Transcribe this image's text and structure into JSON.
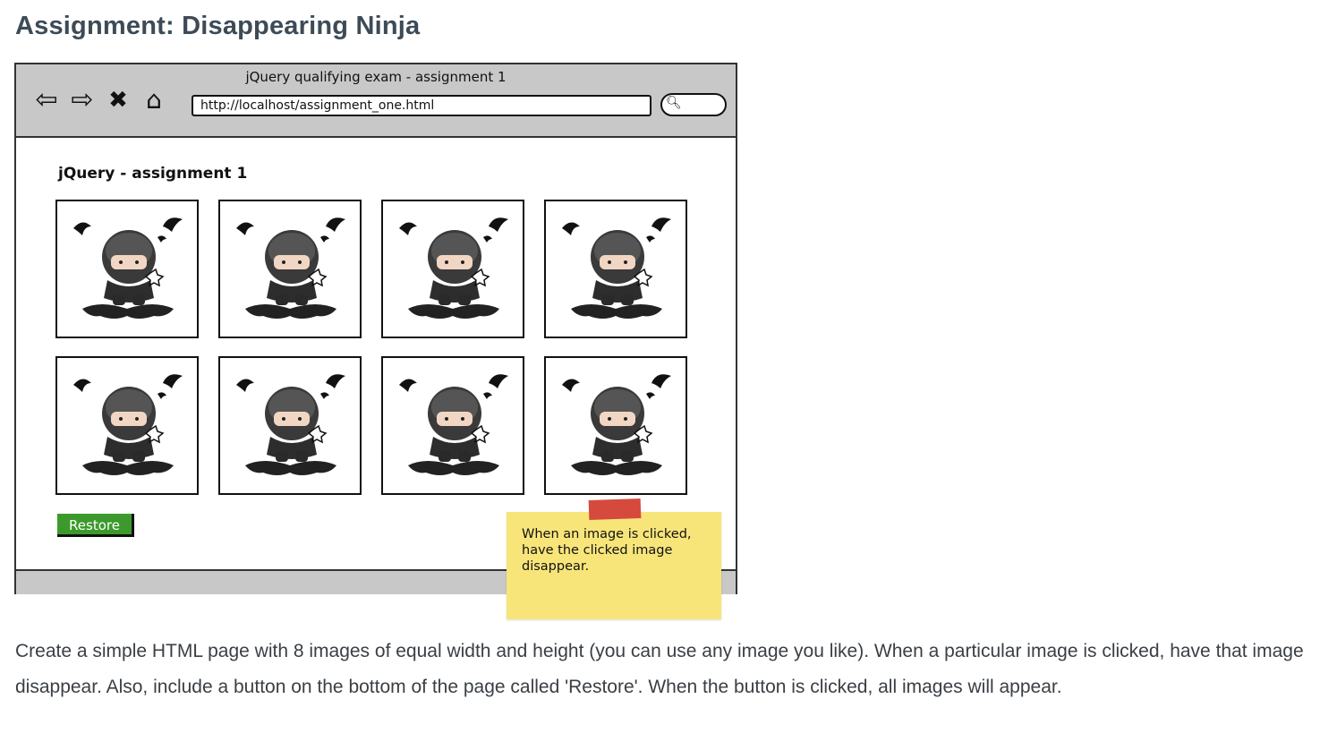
{
  "heading": "Assignment: Disappearing Ninja",
  "mockup": {
    "window_title": "jQuery qualifying exam - assignment 1",
    "nav_icons": [
      "back-arrow-icon",
      "forward-arrow-icon",
      "close-icon",
      "home-icon"
    ],
    "url": "http://localhost/assignment_one.html",
    "search_icon": "search-icon",
    "page_title": "jQuery - assignment 1",
    "images": [
      {
        "icon": "ninja-image"
      },
      {
        "icon": "ninja-image"
      },
      {
        "icon": "ninja-image"
      },
      {
        "icon": "ninja-image"
      },
      {
        "icon": "ninja-image"
      },
      {
        "icon": "ninja-image"
      },
      {
        "icon": "ninja-image"
      },
      {
        "icon": "ninja-image"
      }
    ],
    "restore_label": "Restore",
    "sticky_note": "When an image is clicked, have the clicked image disappear."
  },
  "description": "Create a simple HTML page with 8 images of equal width and height (you can use any image you like). When a particular image is clicked, have that image disappear. Also, include a button on the bottom of the page called 'Restore'. When the button is clicked, all images will appear.",
  "colors": {
    "heading": "#3d4b57",
    "restore_button": "#3c9a2c",
    "sticky_note": "#f8e57a",
    "sticky_tape": "#d64a3e",
    "chrome": "#c8c8c8"
  }
}
